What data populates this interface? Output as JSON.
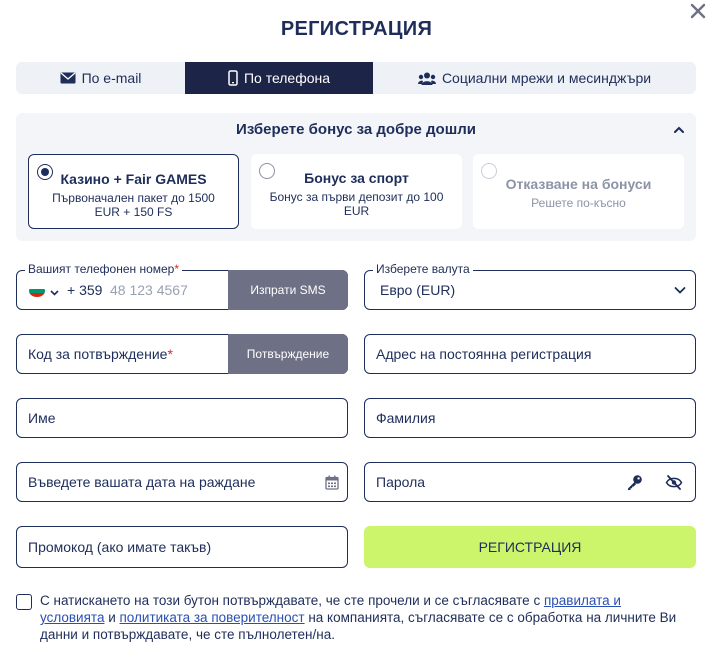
{
  "title": "РЕГИСТРАЦИЯ",
  "tabs": [
    {
      "label": "По e-mail",
      "icon": "envelope-icon",
      "active": false
    },
    {
      "label": "По телефона",
      "icon": "phone-icon",
      "active": true
    },
    {
      "label": "Социални мрежи и месинджъри",
      "icon": "users-icon",
      "active": false
    }
  ],
  "bonus": {
    "heading": "Изберете бонус за добре дошли",
    "cards": [
      {
        "title": "Казино + Fair GAMES",
        "subtitle": "Първоначален пакет до 1500 EUR + 150 FS",
        "selected": true
      },
      {
        "title": "Бонус за спорт",
        "subtitle": "Бонус за първи депозит до 100 EUR",
        "selected": false
      },
      {
        "title": "Отказване на бонуси",
        "subtitle": "Решете по-късно",
        "selected": false
      }
    ]
  },
  "phone": {
    "label": "Вашият телефонен номер",
    "required_mark": "*",
    "country_code": "+ 359",
    "placeholder": "48 123 4567",
    "send_sms": "Изпрати SMS",
    "flag_colors": [
      "#ffffff",
      "#00966e",
      "#d62612"
    ]
  },
  "currency": {
    "label": "Изберете валута",
    "value": "Евро (EUR)"
  },
  "confirmation": {
    "placeholder": "Код за потвърждение",
    "required_mark": "*",
    "button": "Потвърждение"
  },
  "address": {
    "placeholder": "Адрес на постоянна регистрация"
  },
  "first_name": {
    "placeholder": "Име"
  },
  "last_name": {
    "placeholder": "Фамилия"
  },
  "birthdate": {
    "placeholder": "Въведете вашата дата на раждане"
  },
  "password": {
    "placeholder": "Парола"
  },
  "promo": {
    "placeholder": "Промокод (ако имате такъв)"
  },
  "register_button": "РЕГИСТРАЦИЯ",
  "consent": {
    "text_1": "С натискането на този бутон потвърждавате, че сте прочели и се съгласявате с ",
    "link_1": "правилата и условията",
    "text_2": " и ",
    "link_2": "политиката за поверителност",
    "text_3": " на компанията, съгласявате се с обработка на личните Ви данни и потвърждавате, че сте пълнолетен/на."
  },
  "colors": {
    "primary": "#1e2d5a",
    "active_tab": "#1c2447",
    "button_gray": "#6e7185",
    "register_green": "#cdf56b",
    "required_red": "#d12a2a"
  }
}
